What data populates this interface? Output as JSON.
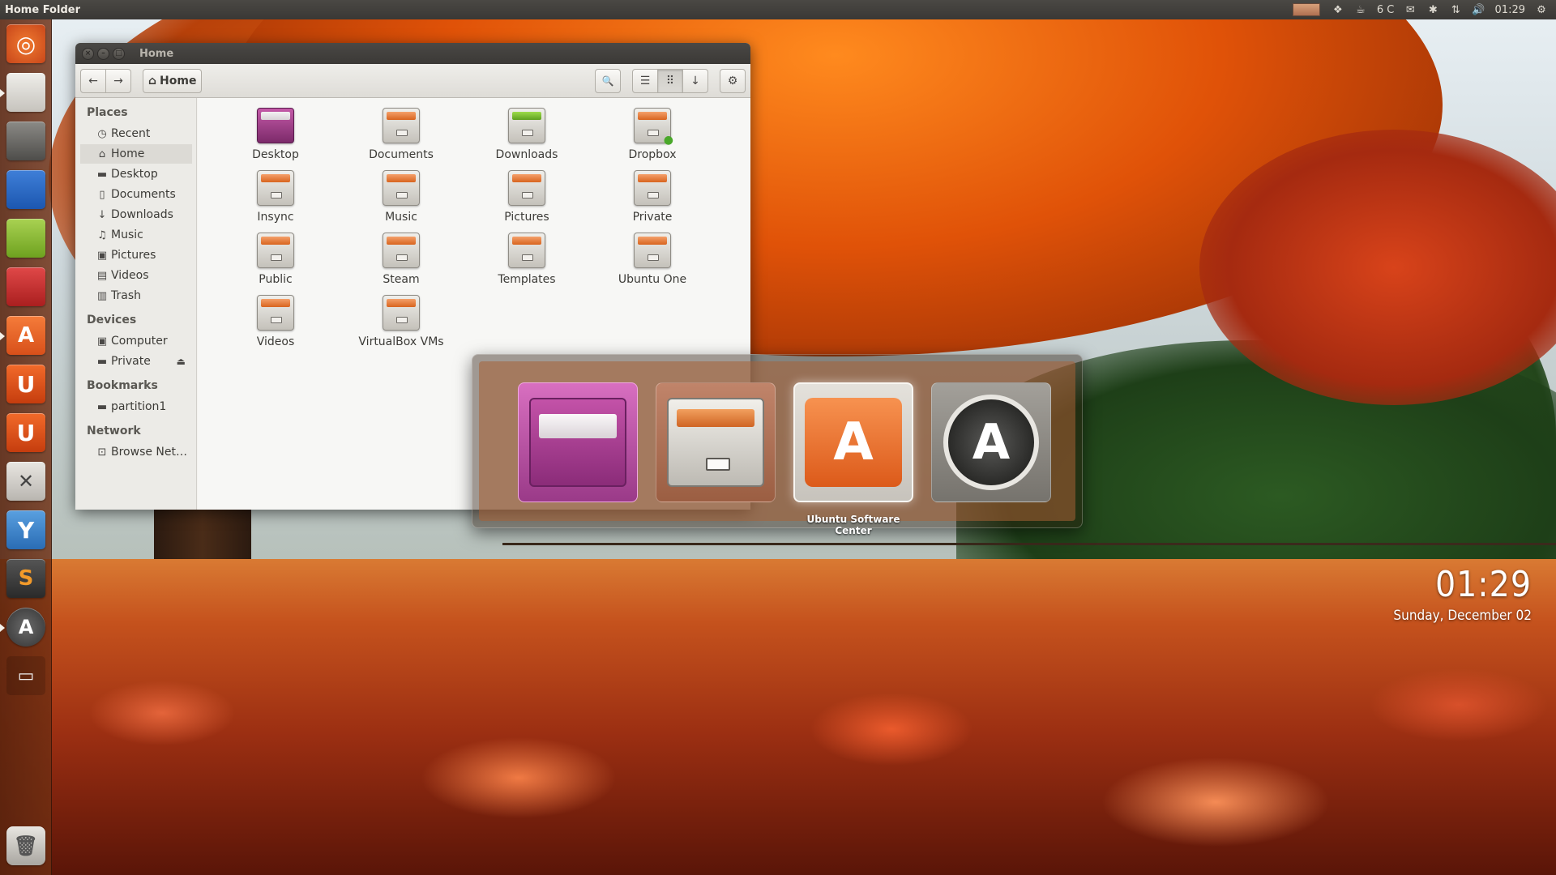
{
  "top_panel": {
    "app_title": "Home Folder",
    "indicators": {
      "dropbox": "❖",
      "cup": "☕",
      "weather": "6 C",
      "mail": "✉",
      "bluetooth": "✱",
      "network": "⇅",
      "volume": "🔊",
      "clock": "01:29",
      "session": "⚙"
    }
  },
  "launcher": {
    "items": [
      {
        "name": "dash",
        "glyph": "◎"
      },
      {
        "name": "files",
        "glyph": ""
      },
      {
        "name": "steam",
        "glyph": ""
      },
      {
        "name": "libreoffice-writer",
        "glyph": ""
      },
      {
        "name": "libreoffice-calc",
        "glyph": ""
      },
      {
        "name": "libreoffice-impress",
        "glyph": ""
      },
      {
        "name": "ubuntu-software-center",
        "glyph": "A"
      },
      {
        "name": "ubuntu-one",
        "glyph": "U"
      },
      {
        "name": "ubuntu-one-music",
        "glyph": "U"
      },
      {
        "name": "system-tools",
        "glyph": "✕"
      },
      {
        "name": "y-ppa-manager",
        "glyph": "Y"
      },
      {
        "name": "sublime-text",
        "glyph": "S"
      },
      {
        "name": "update-manager",
        "glyph": "A"
      },
      {
        "name": "workspace-switcher",
        "glyph": "▭"
      },
      {
        "name": "trash",
        "glyph": "🗑"
      }
    ]
  },
  "window": {
    "title": "Home",
    "close_glyph": "×",
    "min_glyph": "–",
    "max_glyph": "□",
    "toolbar": {
      "back": "←",
      "forward": "→",
      "breadcrumb_home": "Home",
      "home_glyph": "⌂",
      "search": "🔍",
      "list_view": "☰",
      "grid_view": "⠿",
      "sort": "↓",
      "settings": "⚙"
    },
    "sidebar": {
      "places_header": "Places",
      "places": [
        {
          "label": "Recent",
          "icon": "◷"
        },
        {
          "label": "Home",
          "icon": "⌂"
        },
        {
          "label": "Desktop",
          "icon": "▬"
        },
        {
          "label": "Documents",
          "icon": "▯"
        },
        {
          "label": "Downloads",
          "icon": "↓"
        },
        {
          "label": "Music",
          "icon": "♫"
        },
        {
          "label": "Pictures",
          "icon": "▣"
        },
        {
          "label": "Videos",
          "icon": "▤"
        },
        {
          "label": "Trash",
          "icon": "▥"
        }
      ],
      "devices_header": "Devices",
      "devices": [
        {
          "label": "Computer",
          "icon": "▣"
        },
        {
          "label": "Private",
          "icon": "▬",
          "eject": "⏏"
        }
      ],
      "bookmarks_header": "Bookmarks",
      "bookmarks": [
        {
          "label": "partition1",
          "icon": "▬"
        }
      ],
      "network_header": "Network",
      "network": [
        {
          "label": "Browse Net…",
          "icon": "⊡"
        }
      ]
    },
    "files": [
      "Desktop",
      "Documents",
      "Downloads",
      "Dropbox",
      "Insync",
      "Music",
      "Pictures",
      "Private",
      "Public",
      "Steam",
      "Templates",
      "Ubuntu One",
      "Videos",
      "VirtualBox VMs"
    ]
  },
  "switcher": {
    "apps": [
      "Workspace Switcher",
      "Files",
      "Ubuntu Software Center",
      "Update Manager"
    ],
    "selected_label": "Ubuntu Software Center",
    "usc_glyph": "A",
    "update_glyph": "A"
  },
  "desktop_clock": {
    "time": "01:29",
    "date": "Sunday, December 02"
  }
}
